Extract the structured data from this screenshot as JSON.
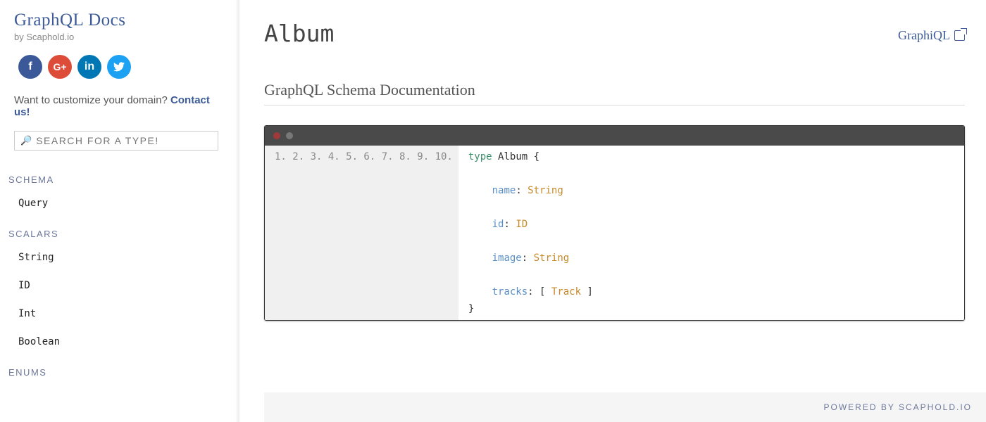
{
  "sidebar": {
    "title": "GraphQL Docs",
    "subtitle": "by Scaphold.io",
    "cta_text": "Want to customize your domain? ",
    "cta_link": "Contact us!",
    "search_placeholder": "SEARCH FOR A TYPE!",
    "sections": [
      {
        "title": "SCHEMA",
        "items": [
          "Query"
        ]
      },
      {
        "title": "SCALARS",
        "items": [
          "String",
          "ID",
          "Int",
          "Boolean"
        ]
      },
      {
        "title": "ENUMS",
        "items": []
      }
    ]
  },
  "main": {
    "page_title": "Album",
    "graphiql_label": "GraphiQL",
    "subtitle": "GraphQL Schema Documentation",
    "code": {
      "line_numbers": [
        "1.",
        "2.",
        "3.",
        "4.",
        "5.",
        "6.",
        "7.",
        "8.",
        "9.",
        "10."
      ],
      "lines": [
        [
          {
            "t": "type ",
            "c": "kw"
          },
          {
            "t": "Album {",
            "c": ""
          }
        ],
        [
          {
            "t": "",
            "c": ""
          }
        ],
        [
          {
            "t": "    ",
            "c": ""
          },
          {
            "t": "name",
            "c": "name"
          },
          {
            "t": ": ",
            "c": ""
          },
          {
            "t": "String",
            "c": "type"
          }
        ],
        [
          {
            "t": "",
            "c": ""
          }
        ],
        [
          {
            "t": "    ",
            "c": ""
          },
          {
            "t": "id",
            "c": "name"
          },
          {
            "t": ": ",
            "c": ""
          },
          {
            "t": "ID",
            "c": "type"
          }
        ],
        [
          {
            "t": "",
            "c": ""
          }
        ],
        [
          {
            "t": "    ",
            "c": ""
          },
          {
            "t": "image",
            "c": "name"
          },
          {
            "t": ": ",
            "c": ""
          },
          {
            "t": "String",
            "c": "type"
          }
        ],
        [
          {
            "t": "",
            "c": ""
          }
        ],
        [
          {
            "t": "    ",
            "c": ""
          },
          {
            "t": "tracks",
            "c": "name"
          },
          {
            "t": ": [ ",
            "c": ""
          },
          {
            "t": "Track",
            "c": "type"
          },
          {
            "t": " ]",
            "c": ""
          }
        ],
        [
          {
            "t": "}",
            "c": ""
          }
        ]
      ]
    }
  },
  "footer": {
    "text": "POWERED BY SCAPHOLD.IO"
  }
}
